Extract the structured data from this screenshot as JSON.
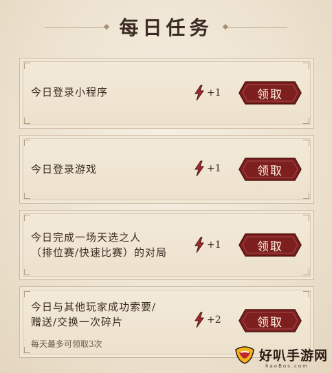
{
  "header": {
    "title": "每日任务"
  },
  "tasks": [
    {
      "text_lines": [
        "今日登录小程序"
      ],
      "reward": "+1",
      "button": "领取"
    },
    {
      "text_lines": [
        "今日登录游戏"
      ],
      "reward": "+1",
      "button": "领取"
    },
    {
      "text_lines": [
        "今日完成一场天选之人",
        "（排位赛/快速比赛）的对局"
      ],
      "reward": "+1",
      "button": "领取"
    },
    {
      "text_lines": [
        "今日与其他玩家成功索要/",
        "赠送/交换一次碎片"
      ],
      "note": "每天最多可领取3次",
      "reward": "+2",
      "button": "领取"
    }
  ],
  "icons": {
    "reward_icon": "lightning-icon",
    "logo_icon": "mouth-logo-icon"
  },
  "colors": {
    "button_red": "#7d1f1f",
    "icon_red": "#b0262a",
    "background": "#efe6d6"
  },
  "watermark": {
    "text": "好叭手游网",
    "subtext": "haoBos.com"
  }
}
